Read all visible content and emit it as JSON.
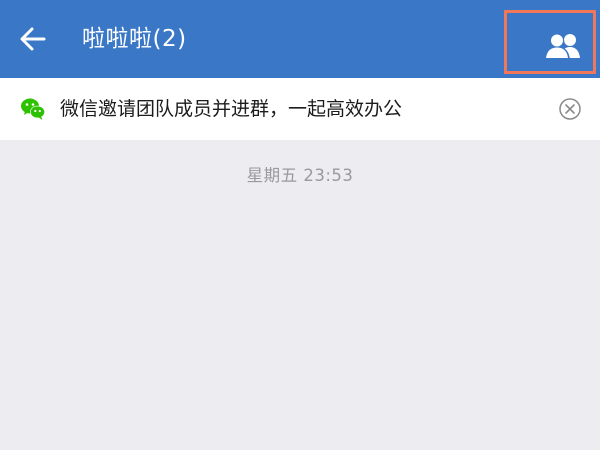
{
  "header": {
    "title": "啦啦啦(2)",
    "background": "#3a77c6",
    "back_icon": "arrow-left-icon",
    "members_icon": "group-members-icon",
    "members_highlight_color": "#f0775a"
  },
  "notice": {
    "icon": "wechat-icon",
    "icon_color": "#2dc100",
    "text": "微信邀请团队成员并进群，一起高效办公",
    "close_icon": "close-circle-icon"
  },
  "chat": {
    "timestamp": "星期五 23:53",
    "background": "#ececf1"
  }
}
